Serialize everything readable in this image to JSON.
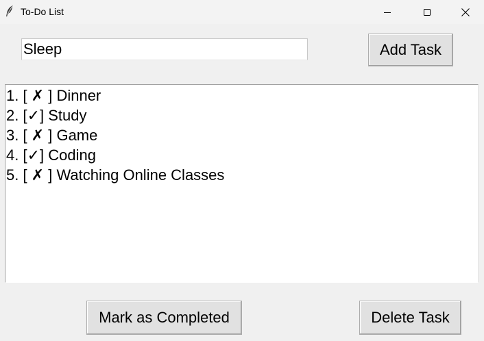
{
  "window": {
    "title": "To-Do List",
    "icon": "feather-icon",
    "controls": [
      "minimize-icon",
      "maximize-icon",
      "close-icon"
    ]
  },
  "entry": {
    "value": "Sleep"
  },
  "buttons": {
    "add_task": "Add Task",
    "mark_completed": "Mark as Completed",
    "delete_task": "Delete Task"
  },
  "tasks": [
    {
      "text": "1. [ ✗ ] Dinner",
      "completed": false
    },
    {
      "text": "2. [✓] Study",
      "completed": true
    },
    {
      "text": "3. [ ✗ ] Game",
      "completed": false
    },
    {
      "text": "4. [✓] Coding",
      "completed": true
    },
    {
      "text": "5. [ ✗ ] Watching Online Classes",
      "completed": false
    }
  ]
}
